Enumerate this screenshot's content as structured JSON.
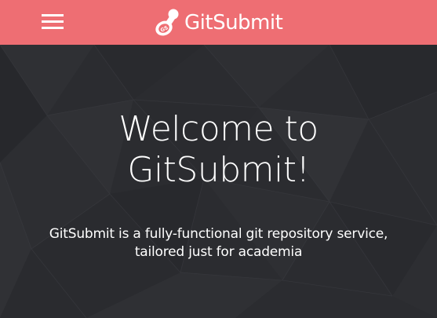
{
  "header": {
    "brand_name": "GitSubmit",
    "brand_logo_icon": "rubber-stamp-icon",
    "menu_icon": "hamburger-menu-icon"
  },
  "hero": {
    "title_line1": "Welcome to",
    "title_line2": "GitSubmit!",
    "subtitle_line1": "GitSubmit is a fully-functional git repository service,",
    "subtitle_line2": "tailored just for academia"
  },
  "colors": {
    "navbar": "#ee6e73",
    "hero_background": "#2a2b2f",
    "text": "#ffffff"
  }
}
